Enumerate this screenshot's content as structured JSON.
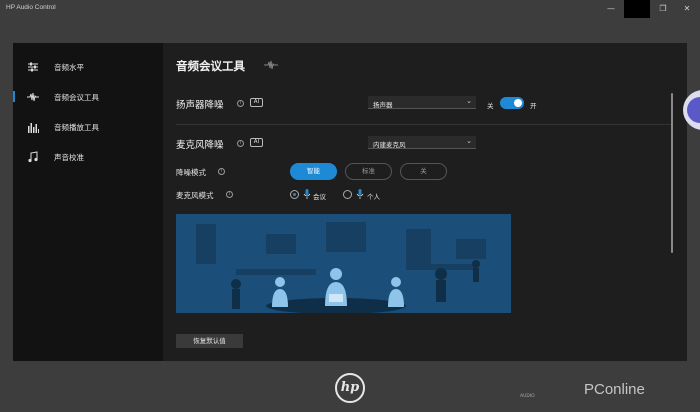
{
  "window": {
    "title": "HP Audio Control",
    "controls": [
      "—",
      "❐",
      "✕"
    ]
  },
  "sidebar": {
    "items": [
      {
        "label": "音频水平",
        "icon": "sliders-icon",
        "selected": false
      },
      {
        "label": "音频会议工具",
        "icon": "waveform-icon",
        "selected": true
      },
      {
        "label": "音频播放工具",
        "icon": "equalizer-icon",
        "selected": false
      },
      {
        "label": "声音校准",
        "icon": "music-note-icon",
        "selected": false
      }
    ]
  },
  "main": {
    "title": "音频会议工具",
    "speaker": {
      "title": "扬声器降噪",
      "ai_badge": "AI",
      "device": "扬声器",
      "toggle_off": "关",
      "toggle_on": "开",
      "enabled": true
    },
    "mic": {
      "title": "麦克风降噪",
      "ai_badge": "AI",
      "device": "内建麦克风",
      "mode_label": "降噪模式",
      "modes": [
        "智能",
        "标准",
        "关"
      ],
      "selected_mode": "智能",
      "mic_mode_label": "麦克风模式",
      "mic_modes": [
        "会议",
        "个人"
      ],
      "selected_mic_mode": "会议"
    },
    "reset_button": "恢复默认值"
  },
  "brand": {
    "logo_text": "hp"
  },
  "watermark": {
    "text": "PConline",
    "small": "AUDIO"
  },
  "colors": {
    "accent": "#1e8ad6",
    "illustration_bg": "#1b4e78"
  }
}
